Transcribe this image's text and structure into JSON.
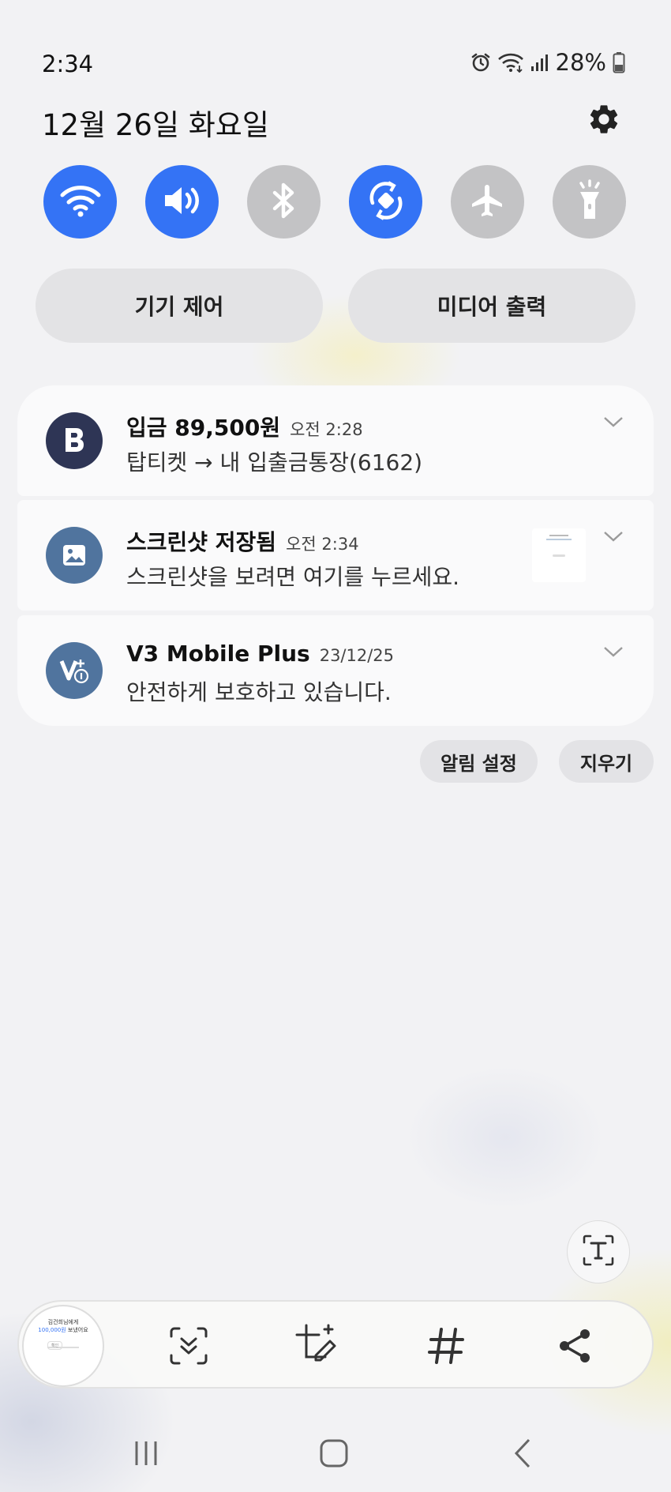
{
  "status_bar": {
    "time": "2:34",
    "battery_percent": "28%",
    "icons": [
      "alarm-icon",
      "wifi-icon",
      "signal-icon",
      "battery-icon"
    ]
  },
  "header": {
    "date": "12월 26일 화요일",
    "settings_icon": "gear-icon"
  },
  "quick_settings": [
    {
      "name": "wifi",
      "icon": "wifi-icon",
      "on": true
    },
    {
      "name": "sound",
      "icon": "speaker-icon",
      "on": true
    },
    {
      "name": "bluetooth",
      "icon": "bluetooth-icon",
      "on": false
    },
    {
      "name": "auto-rotate",
      "icon": "rotate-icon",
      "on": true
    },
    {
      "name": "airplane",
      "icon": "airplane-icon",
      "on": false
    },
    {
      "name": "flashlight",
      "icon": "flashlight-icon",
      "on": false
    }
  ],
  "panel_buttons": {
    "device_control": "기기 제어",
    "media_output": "미디어 출력"
  },
  "notifications": [
    {
      "app": "bank",
      "icon": "bank-b-icon",
      "icon_color": "#2e3555",
      "title": "입금 89,500원",
      "time": "오전 2:28",
      "text": "탑티켓 → 내 입출금통장(6162)"
    },
    {
      "app": "screenshot",
      "icon": "image-icon",
      "icon_color": "#50749e",
      "title": "스크린샷 저장됨",
      "time": "오전 2:34",
      "text": "스크린샷을 보려면 여기를 누르세요."
    },
    {
      "app": "v3",
      "icon": "v3-shield-icon",
      "icon_color": "#50749e",
      "title": "V3 Mobile Plus",
      "time": "23/12/25",
      "text": "안전하게 보호하고 있습니다."
    }
  ],
  "notification_actions": {
    "settings": "알림 설정",
    "clear": "지우기"
  },
  "screenshot_toolbar": {
    "thumbnail": {
      "line1": "김건희님에게",
      "line2": "100,000원",
      "line2b": "보냈어요",
      "button": "확인"
    },
    "icons": [
      "scroll-capture-icon",
      "crop-edit-icon",
      "hashtag-icon",
      "share-icon"
    ],
    "text_extract_icon": "text-extract-icon"
  },
  "nav_bar": {
    "icons": [
      "recents-icon",
      "home-icon",
      "back-icon"
    ]
  },
  "colors": {
    "accent_on": "#3473f5",
    "toggle_off": "#c3c3c5",
    "card_bg": "#fafafb"
  }
}
